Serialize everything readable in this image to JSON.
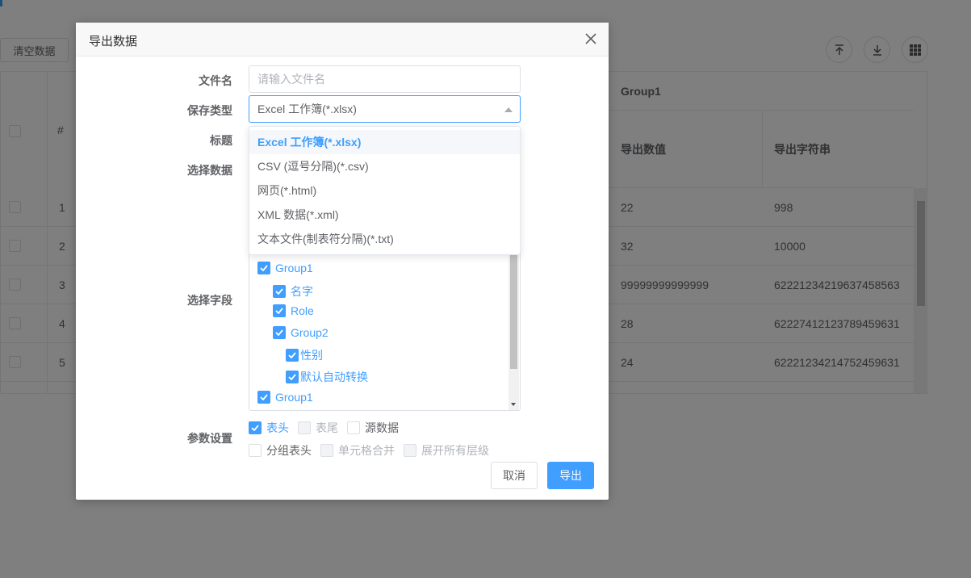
{
  "background": {
    "clear_button": "清空数据",
    "header_group": "Group1",
    "header_cols": [
      "导出数值",
      "导出字符串"
    ],
    "num_header": "#",
    "rows": [
      {
        "num": "1",
        "value": "22",
        "string": "998"
      },
      {
        "num": "2",
        "value": "32",
        "string": "10000"
      },
      {
        "num": "3",
        "value": "99999999999999",
        "string": "62221234219637458563"
      },
      {
        "num": "4",
        "value": "28",
        "string": "62227412123789459631"
      },
      {
        "num": "5",
        "value": "24",
        "string": "62221234214752459631"
      }
    ],
    "toolbar_icons": [
      "import-icon",
      "download-icon",
      "grid-icon"
    ]
  },
  "dialog": {
    "title": "导出数据",
    "labels": {
      "filename": "文件名",
      "save_type": "保存类型",
      "title": "标题",
      "select_data": "选择数据",
      "select_fields": "选择字段",
      "params": "参数设置"
    },
    "filename_placeholder": "请输入文件名",
    "save_type_value": "Excel 工作簿(*.xlsx)",
    "save_type_options": [
      "Excel 工作簿(*.xlsx)",
      "CSV (逗号分隔)(*.csv)",
      "网页(*.html)",
      "XML 数据(*.xml)",
      "文本文件(制表符分隔)(*.txt)"
    ],
    "fields": [
      {
        "label": "Group1",
        "checked": true
      },
      {
        "label": "名字",
        "checked": true
      },
      {
        "label": "Role",
        "checked": true
      },
      {
        "label": "Group2",
        "checked": true
      },
      {
        "label": "性别",
        "checked": true
      },
      {
        "label": "默认自动转换",
        "checked": true
      },
      {
        "label": "Group1",
        "checked": true
      }
    ],
    "params": {
      "header": {
        "label": "表头",
        "state": "checked"
      },
      "footer": {
        "label": "表尾",
        "state": "disabled"
      },
      "source": {
        "label": "源数据",
        "state": "unchecked"
      },
      "group_header": {
        "label": "分组表头",
        "state": "unchecked"
      },
      "merge_cells": {
        "label": "单元格合并",
        "state": "disabled"
      },
      "expand_all": {
        "label": "展开所有层级",
        "state": "disabled"
      }
    },
    "cancel_label": "取消",
    "export_label": "导出"
  },
  "colors": {
    "accent": "#409eff",
    "overlay": "rgba(0,0,0,0.5)"
  }
}
